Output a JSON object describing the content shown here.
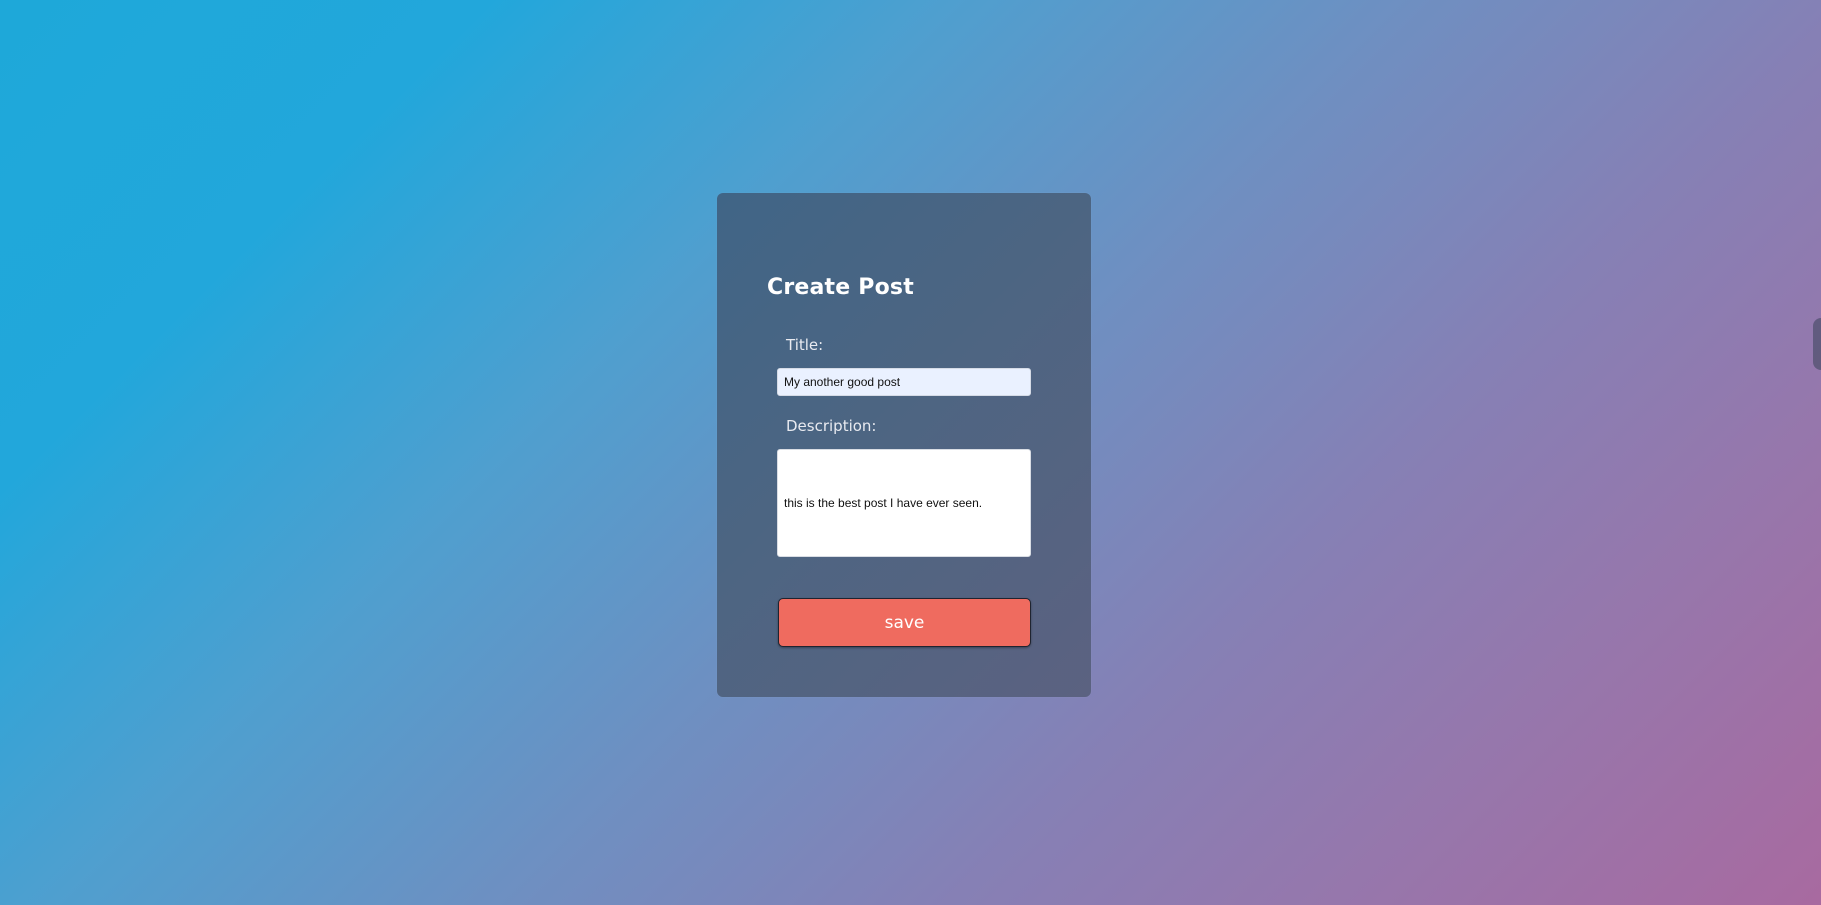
{
  "form": {
    "title": "Create Post",
    "title_label": "Title:",
    "title_value": "My another good post",
    "description_label": "Description:",
    "description_value": "this is the best post I have ever seen.",
    "save_label": "save"
  },
  "colors": {
    "background_start": "#1ea8d9",
    "background_end": "#a86aa0",
    "card": "#4d637f",
    "button": "#ef6b5f",
    "title_input": "#eaf1ff"
  }
}
